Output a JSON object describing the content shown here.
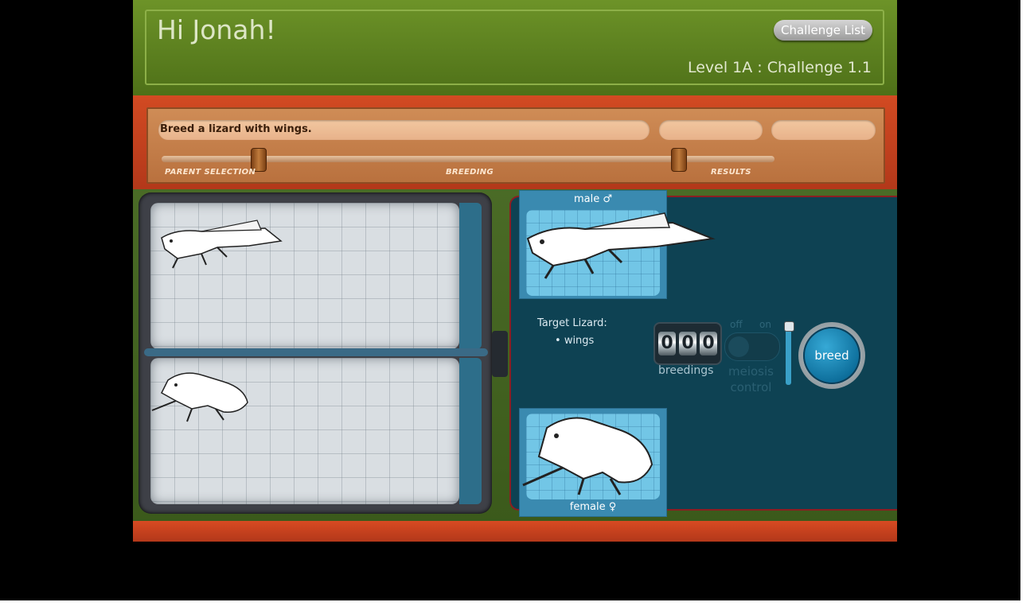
{
  "header": {
    "greeting": "Hi Jonah!",
    "challenge_list_label": "Challenge List",
    "level": "Level 1A : Challenge 1.1"
  },
  "timeline": {
    "goal": "Breed a lizard with wings.",
    "stages": [
      "PARENT SELECTION",
      "BREEDING",
      "RESULTS"
    ]
  },
  "parents": {
    "male_label": "male ♂",
    "female_label": "female ♀"
  },
  "target": {
    "title": "Target Lizard:",
    "traits": [
      "wings"
    ]
  },
  "counter": {
    "digits": [
      "0",
      "0",
      "0"
    ],
    "label": "breedings"
  },
  "meiosis": {
    "off_label": "off",
    "on_label": "on",
    "label_line1": "meiosis",
    "label_line2": "control"
  },
  "breed_button_label": "breed",
  "colors": {
    "header_green": "#5a7f1f",
    "wood_red": "#c8401e",
    "machine_teal": "#0e4253",
    "card_blue": "#3a8ab0"
  }
}
